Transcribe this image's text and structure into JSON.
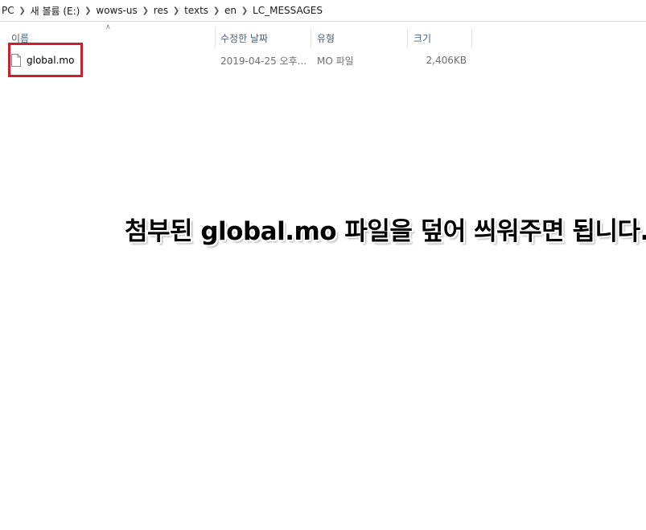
{
  "breadcrumb": {
    "items": [
      "PC",
      "새 볼륨 (E:)",
      "wows-us",
      "res",
      "texts",
      "en",
      "LC_MESSAGES"
    ],
    "separator_icon": "chevron-right-icon"
  },
  "columns": {
    "name": "이름",
    "date_modified": "수정한 날짜",
    "type": "유형",
    "size": "크기",
    "sort_indicator_icon": "caret-up-icon"
  },
  "files": [
    {
      "name": "global.mo",
      "date_modified": "2019-04-25 오후...",
      "type": "MO 파일",
      "size": "2,406KB",
      "icon": "file-icon"
    }
  ],
  "annotation": {
    "highlight_color": "#c7202f",
    "instruction_text": "첨부된 global.mo 파일을 덮어 씌워주면 됩니다."
  }
}
